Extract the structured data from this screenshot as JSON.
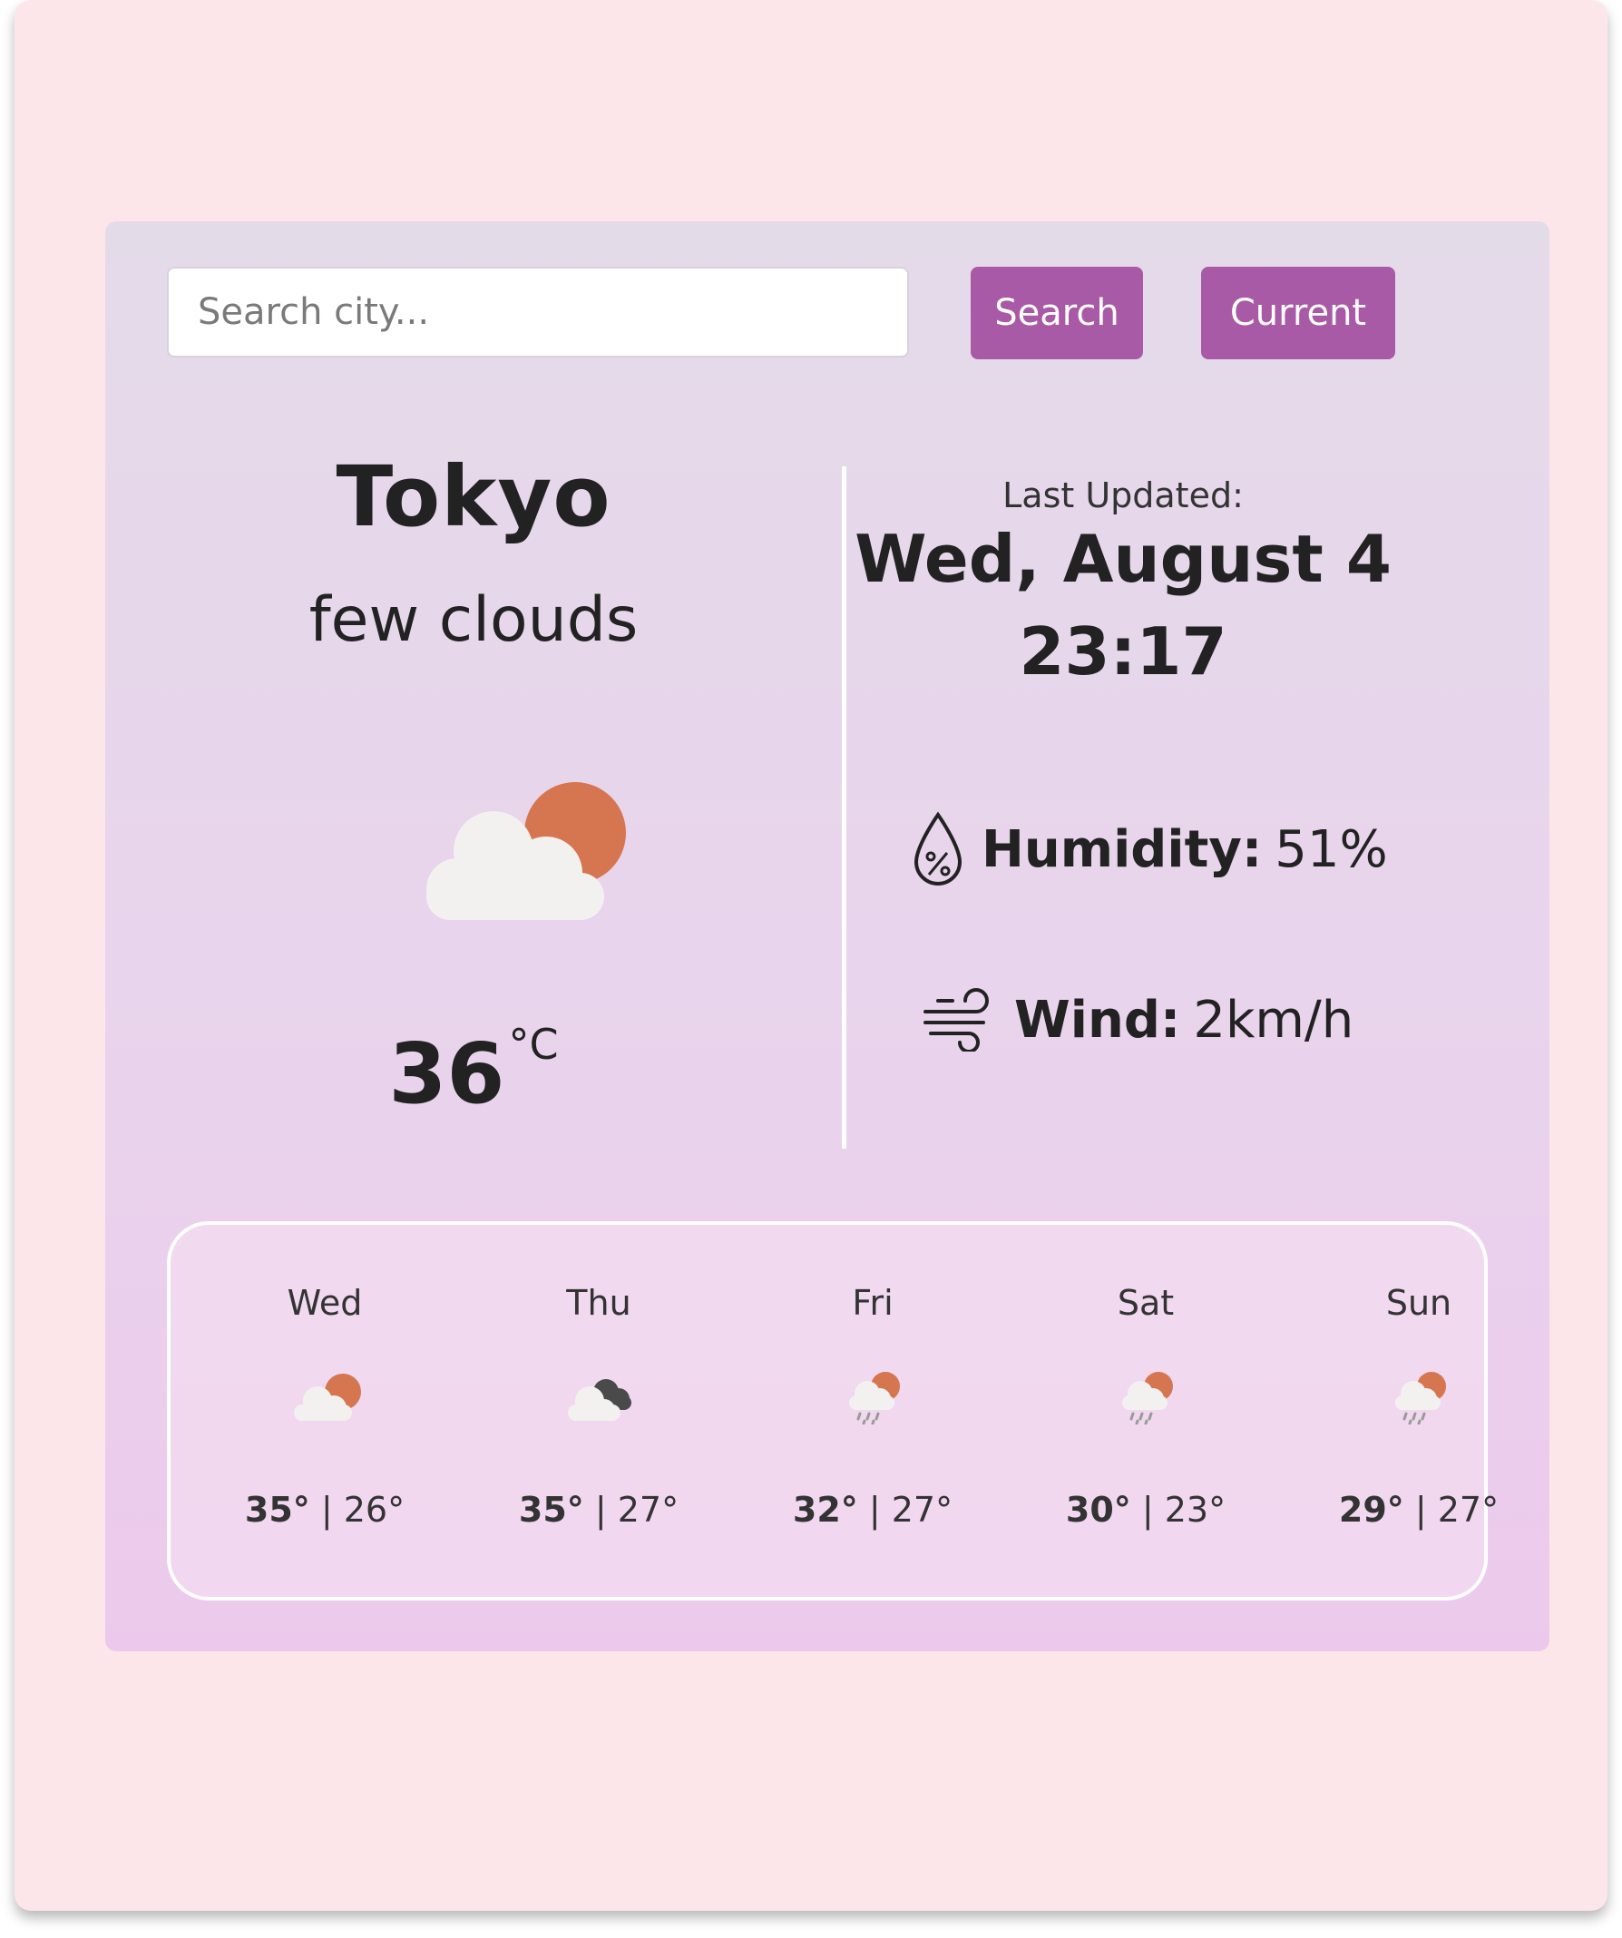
{
  "search": {
    "placeholder": "Search city...",
    "search_label": "Search",
    "current_label": "Current"
  },
  "current": {
    "city": "Tokyo",
    "description": "few clouds",
    "icon": "few-clouds-icon",
    "temperature": "36",
    "unit": "°C",
    "last_updated_label": "Last Updated:",
    "date": "Wed, August 4",
    "time": "23:17",
    "humidity_label": "Humidity:",
    "humidity_value": "51%",
    "wind_label": "Wind:",
    "wind_value": "2km/h"
  },
  "forecast": [
    {
      "day": "Wed",
      "icon": "few-clouds-icon",
      "high": "35°",
      "low": "26°"
    },
    {
      "day": "Thu",
      "icon": "broken-clouds-icon",
      "high": "35°",
      "low": "27°"
    },
    {
      "day": "Fri",
      "icon": "rain-icon",
      "high": "32°",
      "low": "27°"
    },
    {
      "day": "Sat",
      "icon": "rain-icon",
      "high": "30°",
      "low": "23°"
    },
    {
      "day": "Sun",
      "icon": "rain-icon",
      "high": "29°",
      "low": "27°"
    }
  ],
  "colors": {
    "accent": "#a95aa6",
    "background": "#fde6ea",
    "sun": "#d67650",
    "cloud": "#f2f1f0",
    "dark_cloud": "#4a4a4a"
  }
}
